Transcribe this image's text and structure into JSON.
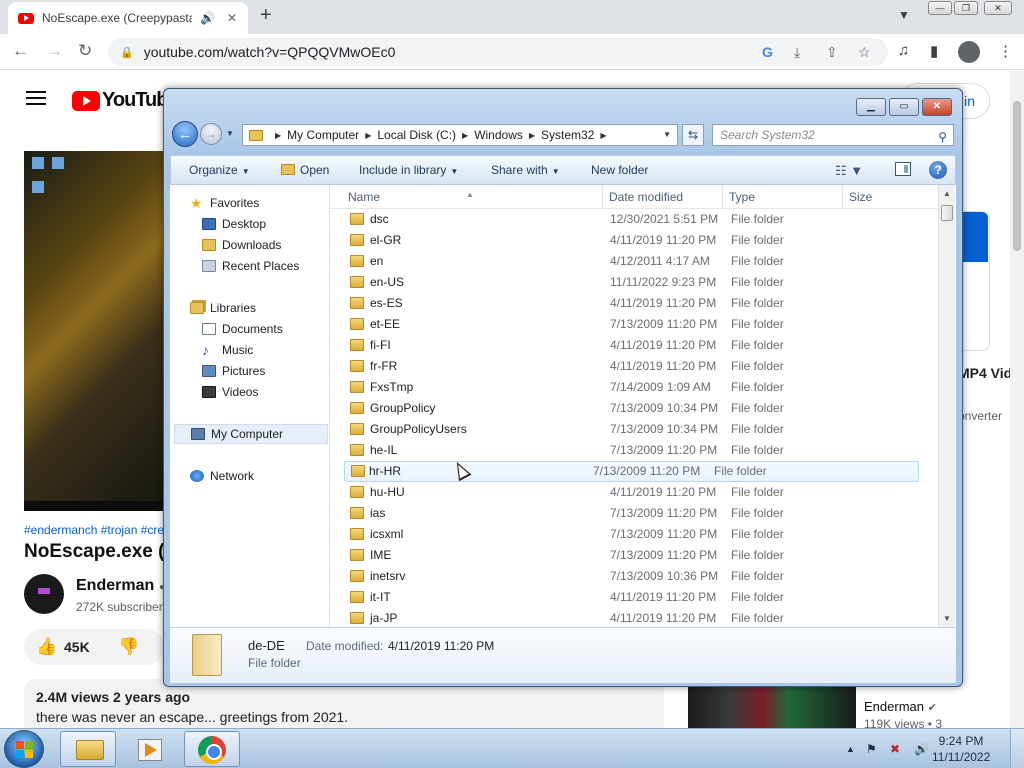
{
  "chrome": {
    "tab_title": "NoEscape.exe (Creepypasta)",
    "audio_icon": "🔊",
    "close_glyph": "✕",
    "new_tab_glyph": "+",
    "url": "youtube.com/watch?v=QPQQVMwOEc0",
    "win_min": "—",
    "win_max": "❐",
    "win_close": "✕"
  },
  "youtube": {
    "logo_text": "YouTube",
    "signin_label": "in",
    "hashtags": "#endermanch #trojan #cre",
    "video_title": "NoEscape.exe (C",
    "channel_name": "Enderman",
    "verified": "✔",
    "subscribers": "272K subscriber",
    "likes": "45K",
    "views_line": "2.4M views  2 years ago",
    "description": "there was never an escape... greetings from 2021.",
    "side_title": "MP4 Vid",
    "side_subtitle": "onverter",
    "rec_channel": "Enderman",
    "rec_meta": "119K views  • 3"
  },
  "explorer": {
    "breadcrumb": [
      "My Computer",
      "Local Disk (C:)",
      "Windows",
      "System32"
    ],
    "search_placeholder": "Search System32",
    "commands": {
      "organize": "Organize",
      "open": "Open",
      "include": "Include in library",
      "share": "Share with",
      "new_folder": "New folder"
    },
    "nav": {
      "favorites": "Favorites",
      "desktop": "Desktop",
      "downloads": "Downloads",
      "recent": "Recent Places",
      "libraries": "Libraries",
      "documents": "Documents",
      "music": "Music",
      "pictures": "Pictures",
      "videos": "Videos",
      "computer": "My Computer",
      "network": "Network"
    },
    "columns": {
      "name": "Name",
      "date": "Date modified",
      "type": "Type",
      "size": "Size"
    },
    "files": [
      {
        "name": "dsc",
        "date": "12/30/2021 5:51 PM",
        "type": "File folder"
      },
      {
        "name": "el-GR",
        "date": "4/11/2019 11:20 PM",
        "type": "File folder"
      },
      {
        "name": "en",
        "date": "4/12/2011 4:17 AM",
        "type": "File folder"
      },
      {
        "name": "en-US",
        "date": "11/11/2022 9:23 PM",
        "type": "File folder"
      },
      {
        "name": "es-ES",
        "date": "4/11/2019 11:20 PM",
        "type": "File folder"
      },
      {
        "name": "et-EE",
        "date": "7/13/2009 11:20 PM",
        "type": "File folder"
      },
      {
        "name": "fi-FI",
        "date": "4/11/2019 11:20 PM",
        "type": "File folder"
      },
      {
        "name": "fr-FR",
        "date": "4/11/2019 11:20 PM",
        "type": "File folder"
      },
      {
        "name": "FxsTmp",
        "date": "7/14/2009 1:09 AM",
        "type": "File folder"
      },
      {
        "name": "GroupPolicy",
        "date": "7/13/2009 10:34 PM",
        "type": "File folder"
      },
      {
        "name": "GroupPolicyUsers",
        "date": "7/13/2009 10:34 PM",
        "type": "File folder"
      },
      {
        "name": "he-IL",
        "date": "7/13/2009 11:20 PM",
        "type": "File folder"
      },
      {
        "name": "hr-HR",
        "date": "7/13/2009 11:20 PM",
        "type": "File folder"
      },
      {
        "name": "hu-HU",
        "date": "4/11/2019 11:20 PM",
        "type": "File folder"
      },
      {
        "name": "ias",
        "date": "7/13/2009 11:20 PM",
        "type": "File folder"
      },
      {
        "name": "icsxml",
        "date": "7/13/2009 11:20 PM",
        "type": "File folder"
      },
      {
        "name": "IME",
        "date": "7/13/2009 11:20 PM",
        "type": "File folder"
      },
      {
        "name": "inetsrv",
        "date": "7/13/2009 10:36 PM",
        "type": "File folder"
      },
      {
        "name": "it-IT",
        "date": "4/11/2019 11:20 PM",
        "type": "File folder"
      },
      {
        "name": "ja-JP",
        "date": "4/11/2019 11:20 PM",
        "type": "File folder"
      }
    ],
    "hovered_row": "hr-HR",
    "details": {
      "name": "de-DE",
      "date_label": "Date modified:",
      "date_value": "4/11/2019 11:20 PM",
      "type": "File folder"
    }
  },
  "taskbar": {
    "time": "9:24 PM",
    "date": "11/11/2022"
  }
}
